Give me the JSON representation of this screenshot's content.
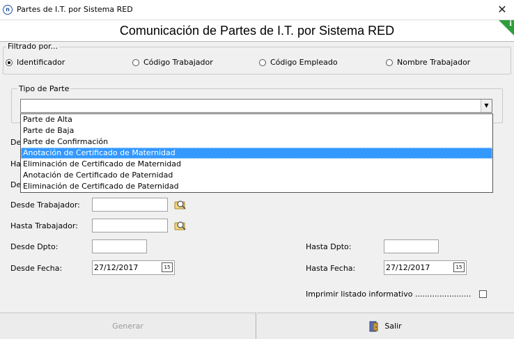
{
  "window": {
    "title": "Partes de I.T. por Sistema RED",
    "close_glyph": "✕"
  },
  "header": {
    "title": "Comunicación de Partes de I.T. por Sistema RED",
    "info_glyph": "i"
  },
  "filter": {
    "legend": "Filtrado por...",
    "options": [
      {
        "label": "Identificador",
        "checked": true
      },
      {
        "label": "Código Trabajador",
        "checked": false
      },
      {
        "label": "Código Empleado",
        "checked": false
      },
      {
        "label": "Nombre Trabajador",
        "checked": false
      }
    ]
  },
  "tipo_parte": {
    "legend": "Tipo de Parte",
    "value": "",
    "options": [
      "Parte de Alta",
      "Parte de Baja",
      "Parte de Confirmación",
      "Anotación de Certificado de Maternidad",
      "Eliminación de Certificado de Maternidad",
      "Anotación de Certificado de Paternidad",
      "Eliminación de Certificado de Paternidad"
    ],
    "selected_index": 3
  },
  "hidden_labels": {
    "l1": "De",
    "l2": "Ha",
    "l3": "De"
  },
  "form": {
    "desde_trabajador_label": "Desde Trabajador:",
    "hasta_trabajador_label": "Hasta Trabajador:",
    "desde_dpto_label": "Desde Dpto:",
    "hasta_dpto_label": "Hasta Dpto:",
    "desde_fecha_label": "Desde Fecha:",
    "hasta_fecha_label": "Hasta Fecha:",
    "desde_fecha_value": "27/12/2017",
    "hasta_fecha_value": "27/12/2017",
    "calendar_glyph": "15",
    "imprimir_label": "Imprimir listado informativo ......................."
  },
  "buttons": {
    "generar": "Generar",
    "salir": "Salir"
  },
  "colors": {
    "selection": "#3399ff",
    "info_badge": "#2e9e3a"
  }
}
